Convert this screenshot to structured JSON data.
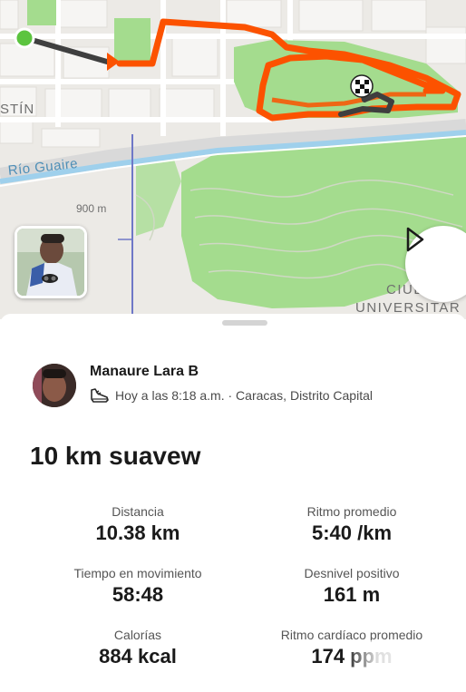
{
  "map": {
    "labels": {
      "agustin": "STÍN",
      "river": "Río Guaire",
      "elevation": "900 m",
      "ciudad": "CIUD",
      "universitaria": "UNIVERSITAR"
    },
    "colors": {
      "route": "#fc5200",
      "route_start_segment": "#3f3f3f",
      "start_marker": "#5cc43f",
      "park": "#a4dc8e",
      "river": "#9fd0ec"
    }
  },
  "activity": {
    "athlete_name": "Manaure Lara B",
    "sport_icon": "shoe-icon",
    "meta": "Hoy a las 8:18 a.m. · Caracas, Distrito Capital",
    "title": "10 km suavew"
  },
  "stats": [
    {
      "label": "Distancia",
      "value": "10.38 km"
    },
    {
      "label": "Ritmo promedio",
      "value": "5:40 /km"
    },
    {
      "label": "Tiempo en movimiento",
      "value": "58:48"
    },
    {
      "label": "Desnivel positivo",
      "value": "161 m"
    },
    {
      "label": "Calorías",
      "value": "884 kcal"
    },
    {
      "label": "Ritmo cardíaco promedio",
      "value": "174 ppm"
    }
  ]
}
